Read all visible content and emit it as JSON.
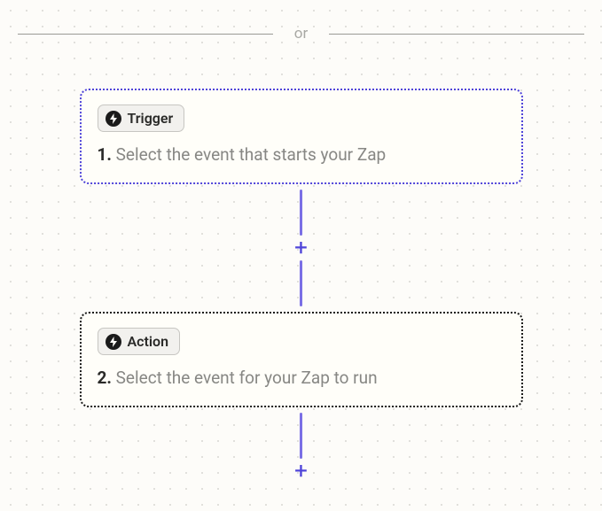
{
  "divider": {
    "label": "or"
  },
  "steps": {
    "trigger": {
      "badge_label": "Trigger",
      "number": "1.",
      "description": "Select the event that starts your Zap"
    },
    "action": {
      "badge_label": "Action",
      "number": "2.",
      "description": "Select the event for your Zap to run"
    }
  },
  "connector": {
    "plus_label": "+"
  }
}
